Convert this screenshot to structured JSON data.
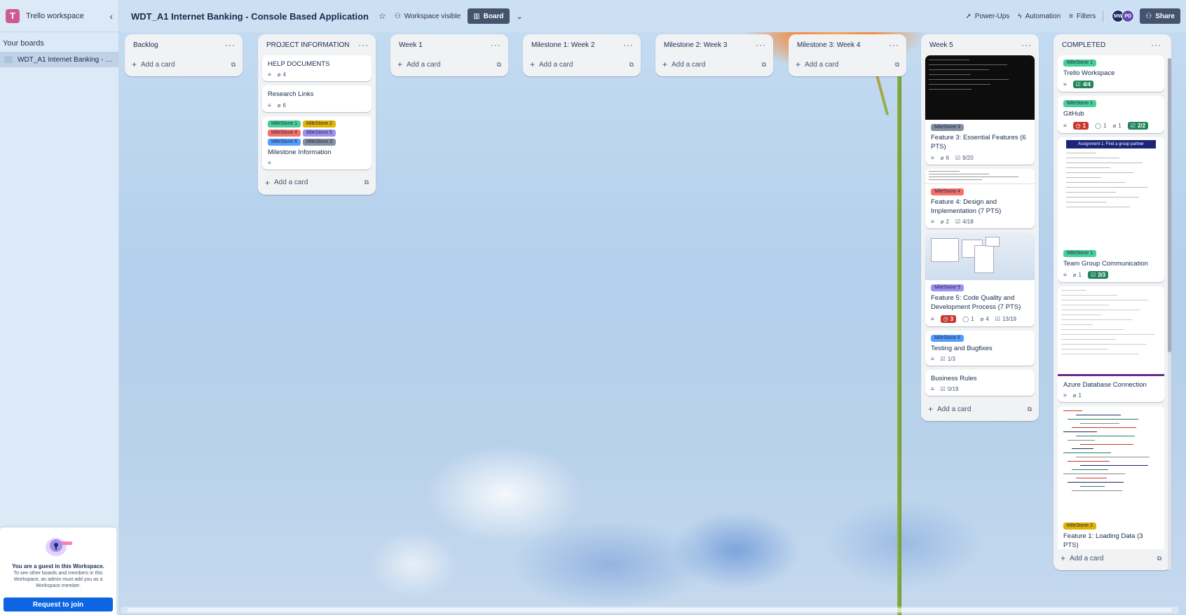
{
  "sidebar": {
    "logo_letter": "T",
    "workspace_name": "Trello workspace",
    "your_boards_label": "Your boards",
    "boards": [
      {
        "label": "WDT_A1 Internet Banking - Co..."
      }
    ],
    "guest": {
      "title": "You are a guest in this Workspace.",
      "description": "To see other boards and members in this Workspace, an admin must add you as a Workspace member.",
      "button_label": "Request to join"
    }
  },
  "topbar": {
    "title": "WDT_A1 Internet Banking - Console Based Application",
    "visibility_label": "Workspace visible",
    "view_label": "Board",
    "powerups_label": "Power-Ups",
    "automation_label": "Automation",
    "filters_label": "Filters",
    "members": [
      "MW",
      "PD"
    ],
    "share_label": "Share"
  },
  "add_card_label": "Add a card",
  "label_colors": {
    "MileStone 1": "#4bce97",
    "MileStone 2": "#e2b203",
    "MileStone 3": "#8590a2",
    "MileStone 4": "#f87168",
    "MileStone 5": "#9f8fef",
    "MileStone 6": "#579dff"
  },
  "lists": [
    {
      "name": "Backlog",
      "cards": []
    },
    {
      "name": "PROJECT INFORMATION",
      "cards": [
        {
          "title": "HELP DOCUMENTS",
          "badges": {
            "attachments": "4"
          }
        },
        {
          "title": "Research Links",
          "badges": {
            "attachments": "6"
          }
        },
        {
          "title": "Milestone Information",
          "labels": [
            "MileStone 1",
            "MileStone 2",
            "MileStone 4",
            "MileStone 5",
            "MileStone 6",
            "MileStone 3"
          ]
        }
      ]
    },
    {
      "name": "Week 1",
      "cards": []
    },
    {
      "name": "Milestone 1: Week 2",
      "cards": []
    },
    {
      "name": "Milestone 2: Week 3",
      "cards": []
    },
    {
      "name": "Milestone 3: Week 4",
      "cards": []
    },
    {
      "name": "Week 5",
      "cards": [
        {
          "title": "Feature 3: Essential Features (6 PTS)",
          "labels": [
            "MileStone 3"
          ],
          "badges": {
            "attachments": "6",
            "checklist": "9/20"
          }
        },
        {
          "title": "Feature 4: Design and Implementation (7 PTS)",
          "labels": [
            "MileStone 4"
          ],
          "badges": {
            "attachments": "2",
            "checklist": "4/18"
          }
        },
        {
          "title": "Feature 5: Code Quality and Development Process (7 PTS)",
          "labels": [
            "MileStone 5"
          ],
          "badges": {
            "red": "3",
            "comments": "1",
            "attachments": "4",
            "checklist": "13/19"
          }
        },
        {
          "title": "Testing and Bugfixes",
          "labels": [
            "MileStone 6"
          ],
          "badges": {
            "checklist": "1/3"
          }
        },
        {
          "title": "Business Rules",
          "badges": {
            "checklist": "0/19"
          }
        }
      ]
    },
    {
      "name": "COMPLETED",
      "cards": [
        {
          "title": "Trello Workspace",
          "labels": [
            "MileStone 1"
          ],
          "badges": {
            "checklist": "4/4"
          }
        },
        {
          "title": "GitHub",
          "labels": [
            "MileStone 1"
          ],
          "badges": {
            "red": "1",
            "comments": "1",
            "attachments": "1",
            "checklist": "2/2"
          }
        },
        {
          "title": "Team Group Communication",
          "labels": [
            "MileStone 1"
          ],
          "cover_text": "Assignment 1: Find a group partner",
          "badges": {
            "attachments": "1",
            "checklist": "3/3"
          }
        },
        {
          "title": "Azure Database Connection",
          "badges": {
            "attachments": "1"
          }
        },
        {
          "title": "Feature 1: Loading Data (3 PTS)",
          "labels": [
            "MileStone 2"
          ]
        }
      ]
    }
  ]
}
